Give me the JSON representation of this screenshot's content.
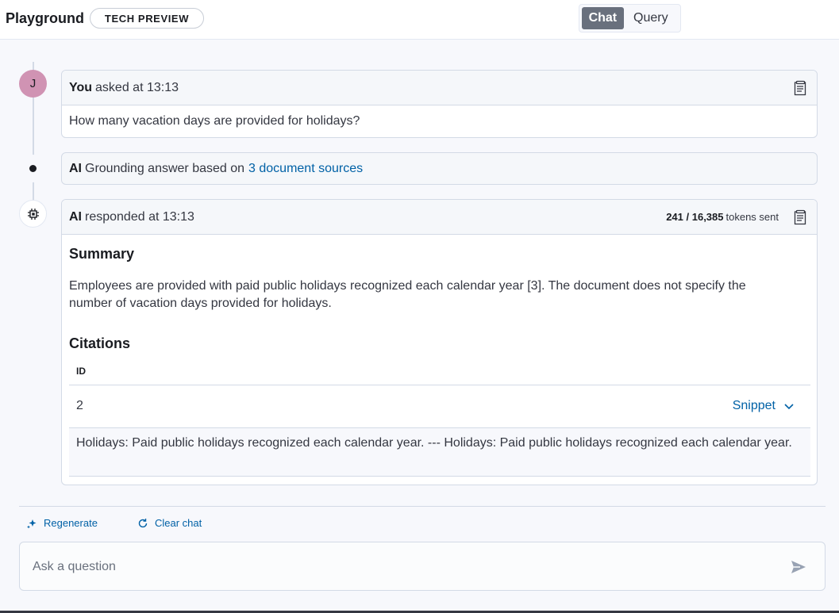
{
  "header": {
    "title": "Playground",
    "badge": "TECH PREVIEW",
    "modes": {
      "chat": "Chat",
      "query": "Query"
    }
  },
  "user_avatar": {
    "initial": "J"
  },
  "question": {
    "author": "You",
    "meta": "asked at 13:13",
    "text": "How many vacation days are provided for holidays?"
  },
  "grounding": {
    "author": "AI",
    "text": "Grounding answer based on",
    "link": "3 document sources"
  },
  "answer": {
    "author": "AI",
    "meta": "responded at 13:13",
    "tokens_count": "241 / 16,385",
    "tokens_suffix": "tokens sent",
    "summary_heading": "Summary",
    "summary_text": "Employees are provided with paid public holidays recognized each calendar year [3]. The document does not specify the number of vacation days provided for holidays.",
    "citations_heading": "Citations",
    "table": {
      "header_id": "ID",
      "rows": [
        {
          "id": "2",
          "action": "Snippet",
          "snippet": "Holidays: Paid public holidays recognized each calendar year. --- Holidays: Paid public holidays recognized each calendar year."
        }
      ]
    }
  },
  "actions": {
    "regenerate": "Regenerate",
    "clear": "Clear chat"
  },
  "input": {
    "placeholder": "Ask a question"
  },
  "colors": {
    "accent": "#0061a6",
    "avatar": "#d093b3",
    "toggle_active": "#69707d"
  }
}
